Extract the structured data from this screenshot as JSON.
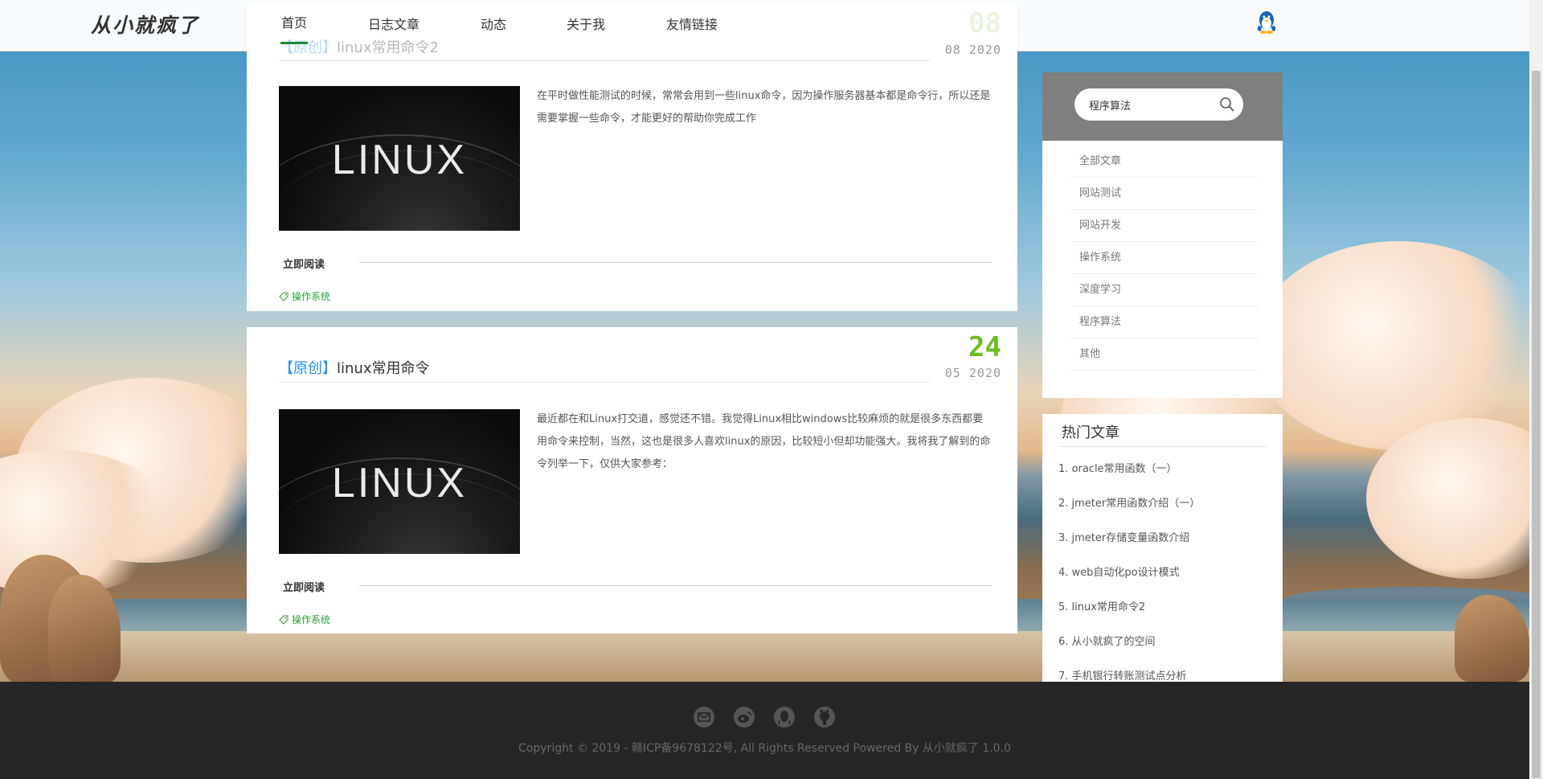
{
  "site": {
    "logo": "从小就疯了"
  },
  "nav": [
    {
      "label": "首页"
    },
    {
      "label": "日志文章"
    },
    {
      "label": "动态"
    },
    {
      "label": "关于我"
    },
    {
      "label": "友情链接"
    }
  ],
  "articles": [
    {
      "tag": "【原创】",
      "title": "linux常用命令2",
      "day": "08",
      "month_year": "08 2020",
      "thumb_text": "LINUX",
      "excerpt": "在平时做性能测试的时候，常常会用到一些linux命令，因为操作服务器基本都是命令行，所以还是需要掌握一些命令，才能更好的帮助你完成工作",
      "read_more": "立即阅读",
      "category": "操作系统"
    },
    {
      "tag": "【原创】",
      "title": "linux常用命令",
      "day": "24",
      "month_year": "05 2020",
      "thumb_text": "LINUX",
      "excerpt": "最近都在和Linux打交道，感觉还不错。我觉得Linux相比windows比较麻烦的就是很多东西都要用命令来控制，当然，这也是很多人喜欢linux的原因，比较短小但却功能强大。我将我了解到的命令列举一下，仅供大家参考：",
      "read_more": "立即阅读",
      "category": "操作系统"
    }
  ],
  "sidebar": {
    "search_value": "程序算法",
    "categories": [
      "全部文章",
      "网站测试",
      "网站开发",
      "操作系统",
      "深度学习",
      "程序算法",
      "其他"
    ],
    "hot_title": "热门文章",
    "hot_items": [
      "1. oracle常用函数（一）",
      "2. jmeter常用函数介绍（一）",
      "3. jmeter存储变量函数介绍",
      "4. web自动化po设计模式",
      "5. linux常用命令2",
      "6. 从小就疯了的空间",
      "7. 手机银行转账测试点分析"
    ]
  },
  "footer": {
    "copyright": "Copyright © 2019 - 赣ICP备9678122号, All Rights Reserved Powered By 从小就疯了 1.0.0"
  },
  "colors": {
    "accent_green": "#1e8a1e",
    "date_green": "#6bbd1e",
    "tag_blue": "#1e90ff",
    "footer_bg": "#262626"
  }
}
